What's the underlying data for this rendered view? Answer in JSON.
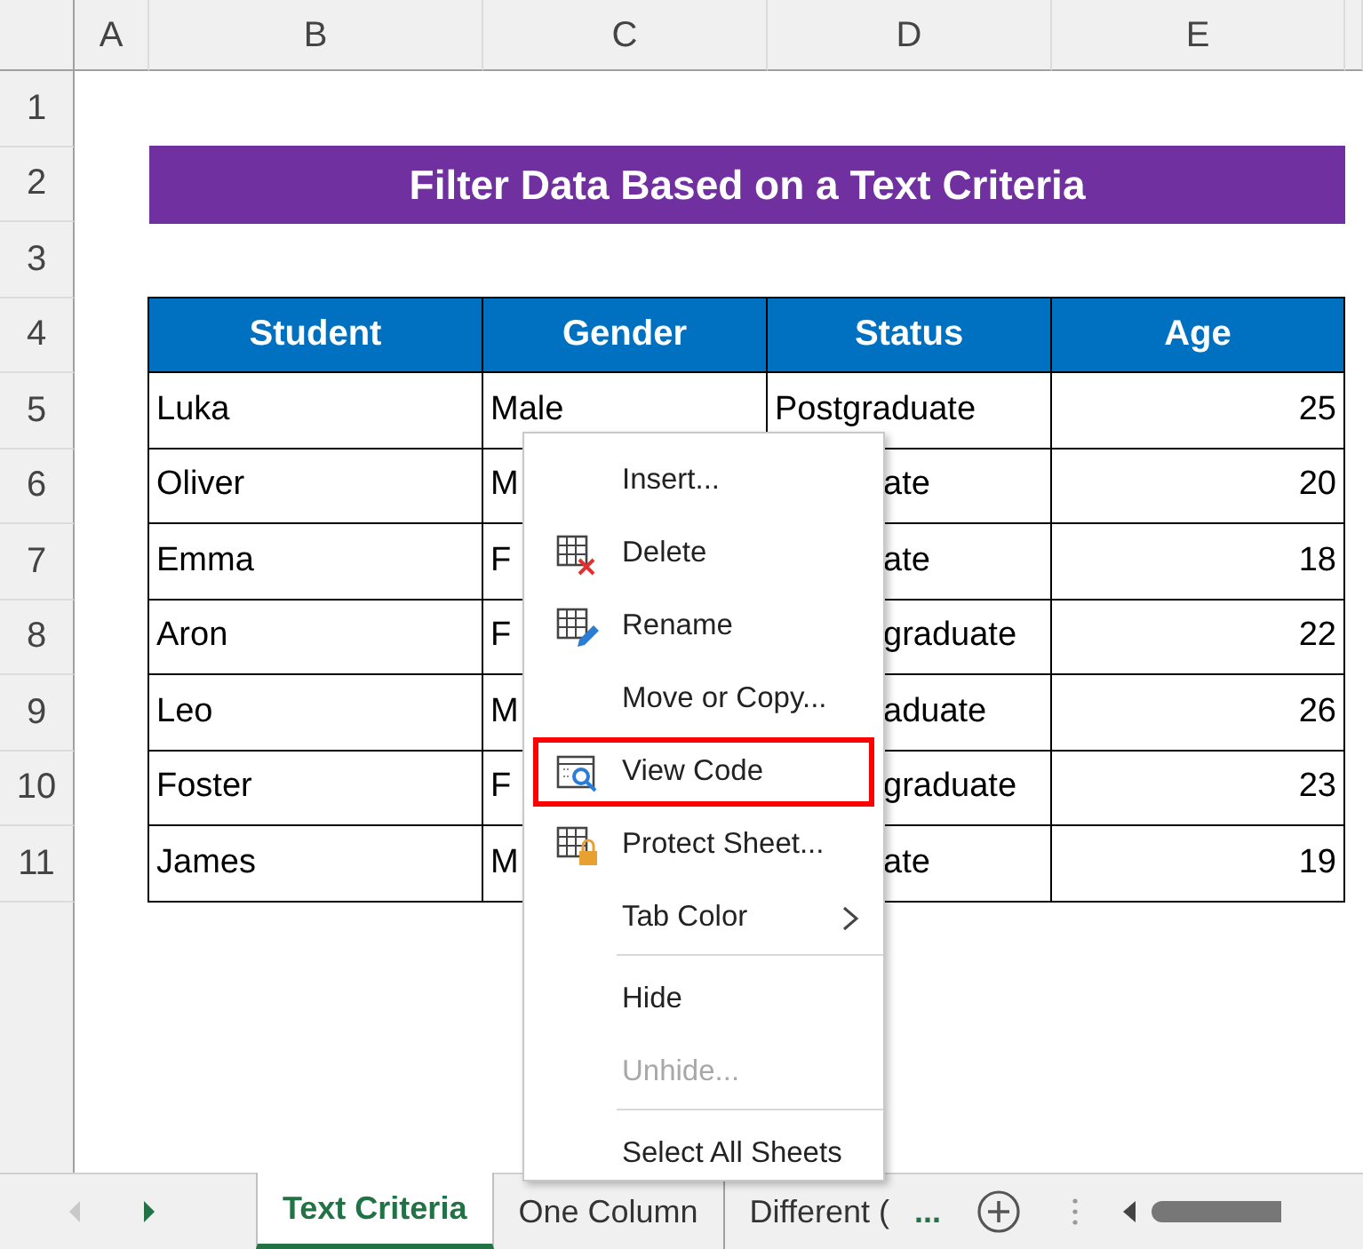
{
  "columns": [
    "A",
    "B",
    "C",
    "D",
    "E"
  ],
  "rows": [
    "1",
    "2",
    "3",
    "4",
    "5",
    "6",
    "7",
    "8",
    "9",
    "10",
    "11"
  ],
  "title": "Filter Data Based on a Text Criteria",
  "table": {
    "columns": [
      "Student",
      "Gender",
      "Status",
      "Age"
    ],
    "rows": [
      {
        "cells": [
          {
            "text": "Luka"
          },
          {
            "text": "Male"
          },
          {
            "text": "Postgraduate",
            "clipped": false
          },
          {
            "text": "25"
          }
        ]
      },
      {
        "cells": [
          {
            "text": "Oliver"
          },
          {
            "text": "M"
          },
          {
            "text": "ate",
            "clipped": true
          },
          {
            "text": "20"
          }
        ]
      },
      {
        "cells": [
          {
            "text": "Emma"
          },
          {
            "text": "F"
          },
          {
            "text": "ate",
            "clipped": true
          },
          {
            "text": "18"
          }
        ]
      },
      {
        "cells": [
          {
            "text": "Aron"
          },
          {
            "text": "F"
          },
          {
            "text": "graduate",
            "clipped": true
          },
          {
            "text": "22"
          }
        ]
      },
      {
        "cells": [
          {
            "text": "Leo"
          },
          {
            "text": "M"
          },
          {
            "text": "aduate",
            "clipped": true
          },
          {
            "text": "26"
          }
        ]
      },
      {
        "cells": [
          {
            "text": "Foster"
          },
          {
            "text": "F"
          },
          {
            "text": "graduate",
            "clipped": true
          },
          {
            "text": "23"
          }
        ]
      },
      {
        "cells": [
          {
            "text": "James"
          },
          {
            "text": "M"
          },
          {
            "text": "ate",
            "clipped": true
          },
          {
            "text": "19"
          }
        ]
      }
    ]
  },
  "context_menu": [
    {
      "label": "Insert...",
      "disabled": false,
      "highlighted": false,
      "submenu": false,
      "separator_before": false
    },
    {
      "label": "Delete",
      "disabled": false,
      "highlighted": false,
      "submenu": false,
      "separator_before": false
    },
    {
      "label": "Rename",
      "disabled": false,
      "highlighted": false,
      "submenu": false,
      "separator_before": false
    },
    {
      "label": "Move or Copy...",
      "disabled": false,
      "highlighted": false,
      "submenu": false,
      "separator_before": false
    },
    {
      "label": "View Code",
      "disabled": false,
      "highlighted": true,
      "submenu": false,
      "separator_before": false
    },
    {
      "label": "Protect Sheet...",
      "disabled": false,
      "highlighted": false,
      "submenu": false,
      "separator_before": false
    },
    {
      "label": "Tab Color",
      "disabled": false,
      "highlighted": false,
      "submenu": true,
      "separator_before": false
    },
    {
      "label": "Hide",
      "disabled": false,
      "highlighted": false,
      "submenu": false,
      "separator_before": true
    },
    {
      "label": "Unhide...",
      "disabled": true,
      "highlighted": false,
      "submenu": false,
      "separator_before": false
    },
    {
      "label": "Select All Sheets",
      "disabled": false,
      "highlighted": false,
      "submenu": false,
      "separator_before": true
    }
  ],
  "sheet_tabs": [
    {
      "label": "Text Criteria",
      "selected": true
    },
    {
      "label": "One Column",
      "selected": false
    },
    {
      "label": "Different (",
      "selected": false
    }
  ],
  "more_tabs": "..."
}
